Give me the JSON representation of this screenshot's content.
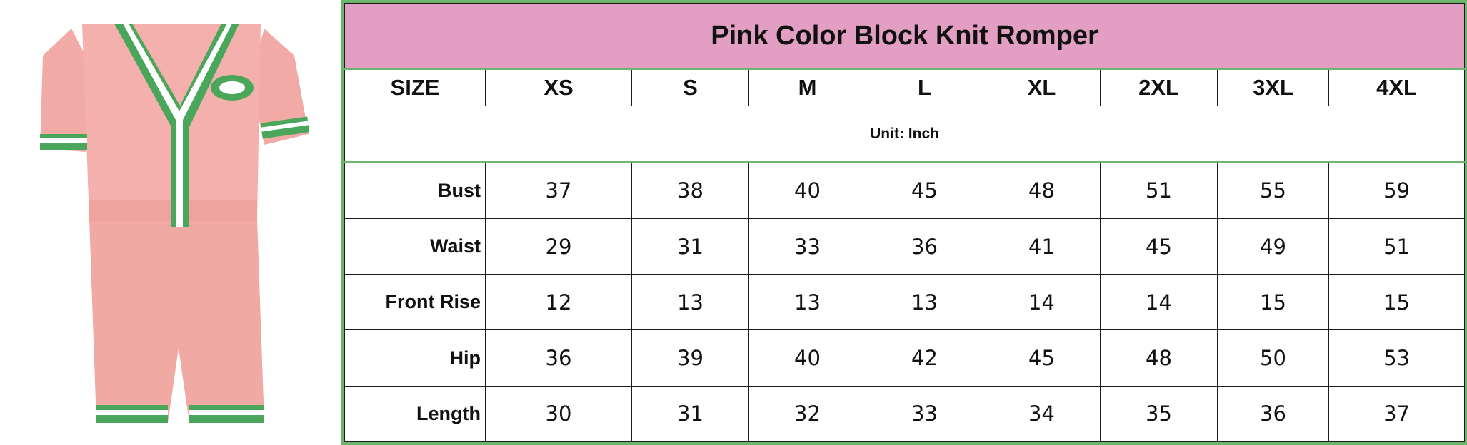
{
  "title": "Pink Color Block Knit Romper",
  "unit": "Unit: Inch",
  "header": [
    "SIZE",
    "XS",
    "S",
    "M",
    "L",
    "XL",
    "2XL",
    "3XL",
    "4XL"
  ],
  "rows": [
    {
      "label": "Bust",
      "values": [
        "37",
        "38",
        "40",
        "45",
        "48",
        "51",
        "55",
        "59"
      ]
    },
    {
      "label": "Waist",
      "values": [
        "29",
        "31",
        "33",
        "36",
        "41",
        "45",
        "49",
        "51"
      ]
    },
    {
      "label": "Front Rise",
      "values": [
        "12",
        "13",
        "13",
        "13",
        "14",
        "14",
        "15",
        "15"
      ]
    },
    {
      "label": "Hip",
      "values": [
        "36",
        "39",
        "40",
        "42",
        "45",
        "48",
        "50",
        "53"
      ]
    },
    {
      "label": "Length",
      "values": [
        "30",
        "31",
        "32",
        "33",
        "34",
        "35",
        "36",
        "37"
      ]
    }
  ],
  "colors": {
    "title_bg": "#e39fc3",
    "border_green": "#6bb56f",
    "garment_pink": "#f2aaa6",
    "trim_green": "#4aa65a"
  },
  "image": {
    "subject": "pink knit romper with green and white trim"
  }
}
